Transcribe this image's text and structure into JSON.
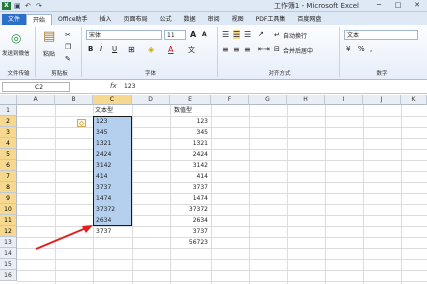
{
  "window": {
    "title": "工作簿1 - Microsoft Excel",
    "min": "─",
    "max": "□",
    "close": "✕"
  },
  "qat": {
    "app_icon": "X",
    "save": "▣",
    "undo": "↶",
    "redo": "↷"
  },
  "tabs": [
    "文件",
    "开始",
    "Office助手",
    "插入",
    "页面布局",
    "公式",
    "数据",
    "审阅",
    "视图",
    "PDF工具集",
    "百度网盘"
  ],
  "ribbon": {
    "send_wechat": "发送到微信",
    "paste": "粘贴",
    "group_filetransfer": "文件传输",
    "group_clipboard": "剪贴板",
    "font_name": "宋体",
    "font_size": "11",
    "grow": "A",
    "shrink": "A",
    "bold": "B",
    "italic": "I",
    "underline": "U",
    "font_color": "A",
    "wen": "文",
    "group_font": "字体",
    "wrap_text": "自动换行",
    "merge_center": "合并后居中",
    "group_align": "对齐方式",
    "number_format": "文本",
    "group_number": "数字",
    "currency": "%",
    "comma": ","
  },
  "formula_bar": {
    "name_box": "C2",
    "fx": "fx",
    "value": "123"
  },
  "columns": [
    "A",
    "B",
    "C",
    "D",
    "E",
    "F",
    "G",
    "H",
    "I",
    "J",
    "K"
  ],
  "rows": [
    "1",
    "2",
    "3",
    "4",
    "5",
    "6",
    "7",
    "8",
    "9",
    "10",
    "11",
    "12",
    "13",
    "14",
    "15",
    "16"
  ],
  "header_c": "文本型",
  "header_e": "数值型",
  "text_values": [
    "123",
    "345",
    "1321",
    "2424",
    "3142",
    "414",
    "3737",
    "1474",
    "37372",
    "2634",
    "3737"
  ],
  "number_values": [
    "123",
    "345",
    "1321",
    "2424",
    "3142",
    "414",
    "3737",
    "1474",
    "37372",
    "2634",
    "3737",
    "56723"
  ],
  "colors": {
    "selection": "#b5d0ee",
    "arrow": "#e02020",
    "file_tab": "#2b6fc9"
  }
}
